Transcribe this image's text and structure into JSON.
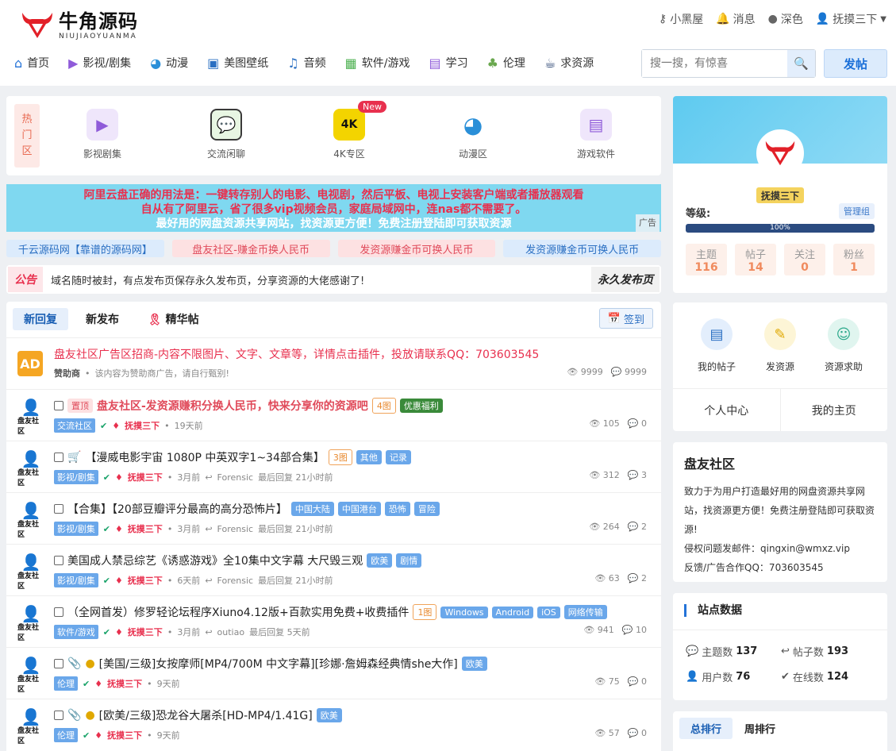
{
  "header": {
    "logo_cn": "牛角源码",
    "logo_en": "NIUJIAOYUANMA",
    "links": [
      {
        "icon": "key-icon",
        "label": "小黑屋"
      },
      {
        "icon": "bell-icon",
        "label": "消息"
      },
      {
        "icon": "moon-icon",
        "label": "深色"
      },
      {
        "icon": "avatar",
        "label": "抚摸三下"
      }
    ]
  },
  "nav": [
    {
      "icon": "home-icon",
      "label": "首页"
    },
    {
      "icon": "video-icon",
      "label": "影视/剧集"
    },
    {
      "icon": "bear-icon",
      "label": "动漫"
    },
    {
      "icon": "image-icon",
      "label": "美图壁纸"
    },
    {
      "icon": "headphones-icon",
      "label": "音频"
    },
    {
      "icon": "grid-icon",
      "label": "软件/游戏"
    },
    {
      "icon": "book-icon",
      "label": "学习"
    },
    {
      "icon": "leaf-icon",
      "label": "伦理"
    },
    {
      "icon": "cup-icon",
      "label": "求资源"
    }
  ],
  "search": {
    "placeholder": "搜一搜，有惊喜",
    "post_label": "发帖"
  },
  "hot": {
    "tag": [
      "热",
      "门",
      "区"
    ],
    "items": [
      {
        "label": "影视剧集",
        "icon": "video-icon"
      },
      {
        "label": "交流闲聊",
        "icon": "wechat-icon"
      },
      {
        "label": "4K专区",
        "icon": "4k-icon",
        "badge": "New"
      },
      {
        "label": "动漫区",
        "icon": "bear-icon"
      },
      {
        "label": "游戏软件",
        "icon": "book-icon"
      }
    ]
  },
  "banner": {
    "line1": "阿里云盘正确的用法是：一键转存别人的电影、电视剧，然后平板、电视上安装客户端或者播放器观看",
    "line2": "自从有了阿里云，省了很多vip视频会员，家庭局域网中，连nas都不需要了。",
    "line3": "最好用的网盘资源共享网站，找资源更方便！免费注册登陆即可获取资源",
    "ad": "广告"
  },
  "links": [
    "千云源码网【靠谱的源码网】",
    "盘友社区-赚金币换人民币",
    "发资源赚金币可换人民币",
    "发资源赚金币可换人民币"
  ],
  "notice": {
    "tag": "公告",
    "text": "域名随时被封，有点发布页保存永久发布页，分享资源的大佬感谢了!",
    "page": "永久发布页"
  },
  "tabs": {
    "new_reply": "新回复",
    "new_post": "新发布",
    "featured": "精华帖",
    "signin": "签到"
  },
  "ad_row": {
    "title": "盘友社区广告区招商-内容不限图片、文字、文章等，详情点击插件，投放请联系QQ：703603545",
    "sponsor": "赞助商",
    "note": "该内容为赞助商广告，请自行甄别!",
    "views": "9999",
    "replies": "9999",
    "badge": "AD"
  },
  "posts": [
    {
      "top": "置顶",
      "title": "盘友社区-发资源赚积分换人民币，快来分享你的资源吧",
      "tags": [
        {
          "t": "4图",
          "c": "o"
        },
        {
          "t": "优惠福利",
          "c": "g"
        }
      ],
      "cat": "交流社区",
      "user": "抚摸三下",
      "time": "19天前",
      "last": "",
      "lasttime": "",
      "views": "105",
      "replies": "0"
    },
    {
      "title": "【漫威电影宇宙 1080P 中英双字1~34部合集】",
      "tags": [
        {
          "t": "3图",
          "c": "o"
        },
        {
          "t": "其他",
          "c": "b"
        },
        {
          "t": "记录",
          "c": "b"
        }
      ],
      "cat": "影视/剧集",
      "user": "抚摸三下",
      "time": "3月前",
      "last": "Forensic",
      "lasttime": "最后回复 21小时前",
      "views": "312",
      "replies": "3",
      "cart": true
    },
    {
      "title": "【合集】【20部豆瓣评分最高的高分恐怖片】",
      "tags": [
        {
          "t": "中国大陆",
          "c": "b"
        },
        {
          "t": "中国港台",
          "c": "b"
        },
        {
          "t": "恐怖",
          "c": "b"
        },
        {
          "t": "冒险",
          "c": "b"
        }
      ],
      "cat": "影视/剧集",
      "user": "抚摸三下",
      "time": "3月前",
      "last": "Forensic",
      "lasttime": "最后回复 21小时前",
      "views": "264",
      "replies": "2"
    },
    {
      "title": "美国成人禁忌综艺《诱惑游戏》全10集中文字幕 大尺毁三观",
      "tags": [
        {
          "t": "欧美",
          "c": "b"
        },
        {
          "t": "剧情",
          "c": "b"
        }
      ],
      "cat": "影视/剧集",
      "user": "抚摸三下",
      "time": "6天前",
      "last": "Forensic",
      "lasttime": "最后回复 21小时前",
      "views": "63",
      "replies": "2"
    },
    {
      "title": "（全网首发）修罗轻论坛程序Xiuno4.12版+百款实用免费+收费插件",
      "tags": [
        {
          "t": "1图",
          "c": "o"
        },
        {
          "t": "Windows",
          "c": "b"
        },
        {
          "t": "Android",
          "c": "b"
        },
        {
          "t": "iOS",
          "c": "b"
        },
        {
          "t": "网络传输",
          "c": "b"
        }
      ],
      "cat": "软件/游戏",
      "user": "抚摸三下",
      "time": "3月前",
      "last": "outiao",
      "lasttime": "最后回复 5天前",
      "views": "941",
      "replies": "10"
    },
    {
      "title": "[美国/三级]女按摩师[MP4/700M 中文字幕][珍娜·詹姆森经典情she大作]",
      "tags": [
        {
          "t": "欧美",
          "c": "b"
        }
      ],
      "cat": "伦理",
      "user": "抚摸三下",
      "time": "9天前",
      "last": "",
      "lasttime": "",
      "views": "75",
      "replies": "0",
      "clip": true,
      "coin": true
    },
    {
      "title": "[欧美/三级]恐龙谷大屠杀[HD-MP4/1.41G]",
      "tags": [
        {
          "t": "欧美",
          "c": "b"
        }
      ],
      "cat": "伦理",
      "user": "抚摸三下",
      "time": "9天前",
      "last": "",
      "lasttime": "",
      "views": "57",
      "replies": "0",
      "clip": true,
      "coin": true
    }
  ],
  "avatar_label": "盘友社区",
  "profile": {
    "name": "抚摸三下",
    "level_label": "等级:",
    "group": "管理组",
    "progress": 100,
    "progress_label": "100%",
    "stats": [
      {
        "label": "主题",
        "value": "116"
      },
      {
        "label": "帖子",
        "value": "14"
      },
      {
        "label": "关注",
        "value": "0"
      },
      {
        "label": "粉丝",
        "value": "1"
      }
    ]
  },
  "quick": {
    "items": [
      {
        "label": "我的帖子",
        "icon": "doc-icon"
      },
      {
        "label": "发资源",
        "icon": "edit-icon"
      },
      {
        "label": "资源求助",
        "icon": "help-icon"
      }
    ],
    "center": "个人中心",
    "home": "我的主页"
  },
  "about": {
    "title": "盘友社区",
    "desc": "致力于为用户打造最好用的网盘资源共享网站，找资源更方便！免费注册登陆即可获取资源!",
    "mail": "侵权问题发邮件：qingxin@wmxz.vip",
    "qq": "反馈/广告合作QQ：703603545"
  },
  "site": {
    "title": "站点数据",
    "topics_label": "主题数",
    "topics": "137",
    "posts_label": "帖子数",
    "posts": "193",
    "users_label": "用户数",
    "users": "76",
    "online_label": "在线数",
    "online": "124"
  },
  "rank": {
    "total": "总排行",
    "week": "周排行"
  }
}
